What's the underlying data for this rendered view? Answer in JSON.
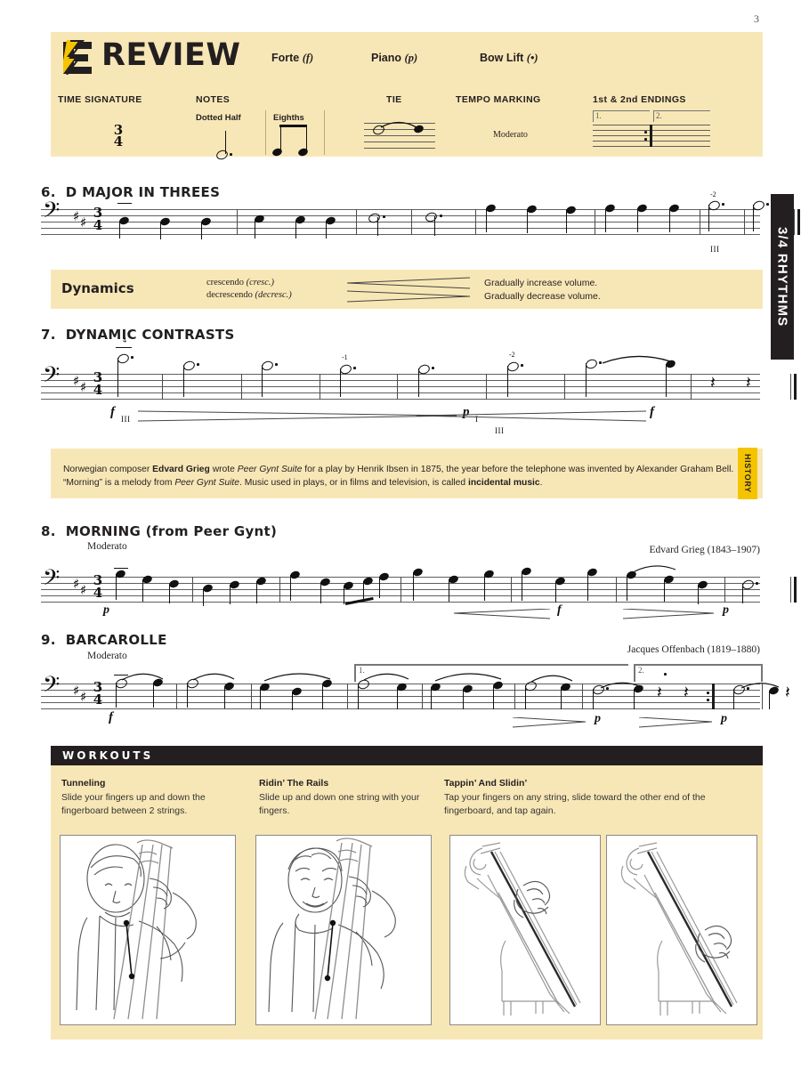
{
  "page": {
    "number": "3",
    "side_tab": "3/4 RHYTHMS",
    "history_tab": "HISTORY"
  },
  "review": {
    "title": "REVIEW",
    "logo_icon": "essential-elements-logo-icon",
    "top_items": [
      {
        "label": "Forte",
        "symbol": "(f)"
      },
      {
        "label": "Piano",
        "symbol": "(p)"
      },
      {
        "label": "Bow Lift",
        "symbol": "(•)"
      }
    ],
    "columns": [
      {
        "header": "TIME SIGNATURE",
        "value": "3/4"
      },
      {
        "header": "NOTES",
        "sub": [
          "Dotted Half",
          "Eighths"
        ]
      },
      {
        "header": "TIE"
      },
      {
        "header": "TEMPO MARKING",
        "value": "Moderato"
      },
      {
        "header": "1st & 2nd ENDINGS",
        "endings": [
          "1.",
          "2."
        ]
      }
    ]
  },
  "exercise6": {
    "number": "6.",
    "title": "D MAJOR IN THREES",
    "time_signature": "3/4",
    "clef": "bass",
    "key": "D major (2 sharps)",
    "string_marking": "III"
  },
  "dynamics_box": {
    "title": "Dynamics",
    "rows": [
      {
        "term": "crescendo",
        "abbr": "(cresc.)",
        "definition": "Gradually increase volume.",
        "sign": "crescendo-hairpin"
      },
      {
        "term": "decrescendo",
        "abbr": "(decresc.)",
        "definition": "Gradually decrease volume.",
        "sign": "decrescendo-hairpin"
      }
    ]
  },
  "exercise7": {
    "number": "7.",
    "title": "DYNAMIC CONTRASTS",
    "time_signature": "3/4",
    "dynamics": [
      "f",
      "p",
      "f"
    ],
    "string_markings": [
      "III",
      "I",
      "III"
    ],
    "fingerings": [
      "4",
      "-1",
      "-2"
    ]
  },
  "history": {
    "tab": "HISTORY",
    "text_parts": [
      {
        "t": "Norwegian composer ",
        "style": "normal"
      },
      {
        "t": "Edvard Grieg",
        "style": "bold"
      },
      {
        "t": " wrote ",
        "style": "normal"
      },
      {
        "t": "Peer Gynt Suite",
        "style": "italic"
      },
      {
        "t": " for a play by Henrik Ibsen in 1875, the year before the telephone was invented by Alexander Graham Bell.  “Morning” is a melody from ",
        "style": "normal"
      },
      {
        "t": "Peer Gynt Suite",
        "style": "italic"
      },
      {
        "t": ".  Music used in plays, or in films and television, is called ",
        "style": "normal"
      },
      {
        "t": "incidental music",
        "style": "bold"
      },
      {
        "t": ".",
        "style": "normal"
      }
    ]
  },
  "exercise8": {
    "number": "8.",
    "title": "MORNING (from Peer Gynt)",
    "tempo": "Moderato",
    "composer": "Edvard Grieg (1843–1907)",
    "time_signature": "3/4",
    "dynamics": [
      "p",
      "f",
      "p"
    ]
  },
  "exercise9": {
    "number": "9.",
    "title": "BARCAROLLE",
    "tempo": "Moderato",
    "composer": "Jacques Offenbach (1819–1880)",
    "time_signature": "3/4",
    "dynamics": [
      "f",
      "p",
      "p"
    ],
    "endings": [
      "1.",
      "2."
    ]
  },
  "workouts": {
    "header": "WORKOUTS",
    "items": [
      {
        "title": "Tunneling",
        "description": "Slide your fingers up and down the fingerboard between 2 strings.",
        "image_icon": "bassist-tunneling-illustration"
      },
      {
        "title": "Ridin’ The Rails",
        "description": "Slide up and down one string with your fingers.",
        "image_icon": "bassist-ridin-rails-illustration"
      },
      {
        "title": "Tappin’ And Slidin’",
        "description": "Tap your fingers on any string, slide toward the other end of the fingerboard, and tap again.",
        "image_icon": "bass-fingerboard-tapping-illustration",
        "image_icon_2": "bass-fingerboard-sliding-illustration"
      }
    ]
  },
  "colors": {
    "cream": "#f8e7b6",
    "dark": "#231f20",
    "gold": "#f5c400"
  }
}
